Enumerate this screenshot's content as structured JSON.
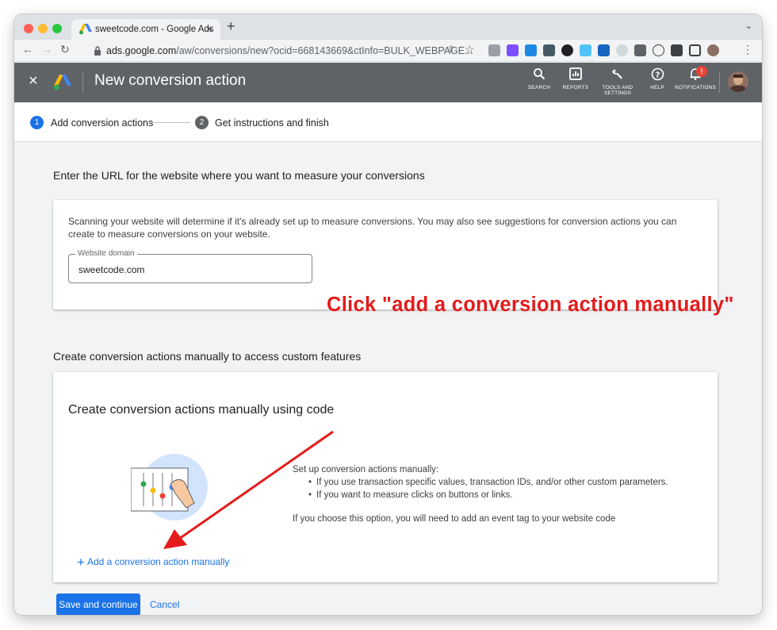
{
  "browser": {
    "tab_title": "sweetcode.com - Google Ads",
    "tab_close": "×",
    "new_tab": "+",
    "tab_menu": "⌄",
    "url_host": "ads.google.com",
    "url_path": "/aw/conversions/new?ocid=668143669&ctInfo=BULK_WEBPAGE..."
  },
  "header": {
    "close": "×",
    "title": "New conversion action",
    "actions": [
      {
        "label": "SEARCH",
        "icon": "search-icon"
      },
      {
        "label": "REPORTS",
        "icon": "reports-icon"
      },
      {
        "label": "TOOLS AND SETTINGS",
        "icon": "wrench-icon"
      },
      {
        "label": "HELP",
        "icon": "help-icon"
      },
      {
        "label": "NOTIFICATIONS",
        "icon": "bell-icon",
        "badge": "!"
      }
    ]
  },
  "stepper": {
    "steps": [
      {
        "num": "1",
        "label": "Add conversion actions",
        "active": true
      },
      {
        "num": "2",
        "label": "Get instructions and finish",
        "active": false
      }
    ]
  },
  "url_section": {
    "heading": "Enter the URL for the website where you want to measure your conversions",
    "description": "Scanning your website will determine if it's already set up to measure conversions. You may also see suggestions for conversion actions you can create to measure conversions on your website.",
    "field_label": "Website domain",
    "field_value": "sweetcode.com"
  },
  "manual_section": {
    "heading": "Create conversion actions manually to access custom features",
    "card_title": "Create conversion actions manually using code",
    "setup_intro": "Set up conversion actions manually:",
    "bullets": [
      "If you use transaction specific values, transaction IDs, and/or other custom parameters.",
      "If you want to measure clicks on buttons or links."
    ],
    "note": "If you choose this option, you will need to add an event tag to your website code",
    "add_link": "Add a conversion action manually",
    "add_plus": "+"
  },
  "footer": {
    "save": "Save and continue",
    "cancel": "Cancel"
  },
  "annotation": {
    "text": "Click \"add a conversion action manually\"",
    "color": "#e31b1b"
  },
  "colors": {
    "accent": "#1a73e8",
    "header_bg": "#5f6368",
    "active_step": "#1a73e8",
    "inactive_step": "#5f6368"
  }
}
